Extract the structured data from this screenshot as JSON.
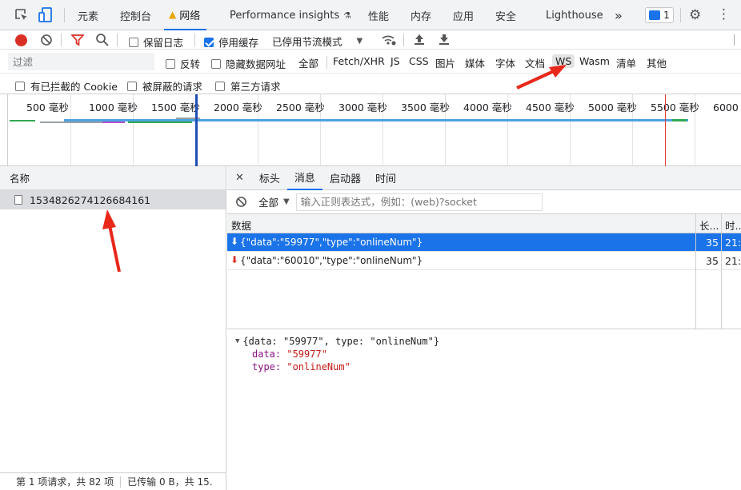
{
  "topbar": {
    "tabs": [
      "元素",
      "控制台",
      "网络",
      "Performance insights",
      "性能",
      "内存",
      "应用",
      "安全",
      "Lighthouse"
    ],
    "more": "»",
    "message_count": "1"
  },
  "toolbar": {
    "preserve_log": "保留日志",
    "disable_cache": "停用缓存",
    "throttling": "已停用节流模式"
  },
  "filter": {
    "placeholder": "过滤",
    "invert": "反转",
    "hide_data_urls": "隐藏数据网址",
    "types": [
      "全部",
      "Fetch/XHR",
      "JS",
      "CSS",
      "图片",
      "媒体",
      "字体",
      "文档",
      "WS",
      "Wasm",
      "清单",
      "其他"
    ],
    "blocked_cookies": "有已拦截的 Cookie",
    "blocked_requests": "被屏蔽的请求",
    "third_party": "第三方请求"
  },
  "timeline": {
    "ticks": [
      "500 毫秒",
      "1000 毫秒",
      "1500 毫秒",
      "2000 毫秒",
      "2500 毫秒",
      "3000 毫秒",
      "3500 毫秒",
      "4000 毫秒",
      "4500 毫秒",
      "5000 毫秒",
      "5500 毫秒",
      "6000 毫"
    ]
  },
  "requests": {
    "header": "名称",
    "items": [
      {
        "name": "1534826274126684161"
      }
    ],
    "footer": "第 1 项请求，共 82 项",
    "footer2": "已传输 0 B，共 15."
  },
  "detail_tabs": [
    "标头",
    "消息",
    "启动器",
    "时间"
  ],
  "messages": {
    "filter_all": "全部",
    "filter_placeholder": "输入正则表达式，例如：(web)?socket",
    "col_data": "数据",
    "col_length": "长...",
    "col_time": "时...",
    "rows": [
      {
        "data": "{\"data\":\"59977\",\"type\":\"onlineNum\"}",
        "length": "35",
        "time": "21:5"
      },
      {
        "data": "{\"data\":\"60010\",\"type\":\"onlineNum\"}",
        "length": "35",
        "time": "21:5"
      }
    ]
  },
  "preview": {
    "summary": "{data: \"59977\", type: \"onlineNum\"}",
    "key1": "data:",
    "val1": "\"59977\"",
    "key2": "type:",
    "val2": "\"onlineNum\""
  },
  "colors": {
    "accent": "#1a73e8",
    "record": "#d93025",
    "annotation": "#e8281a"
  }
}
